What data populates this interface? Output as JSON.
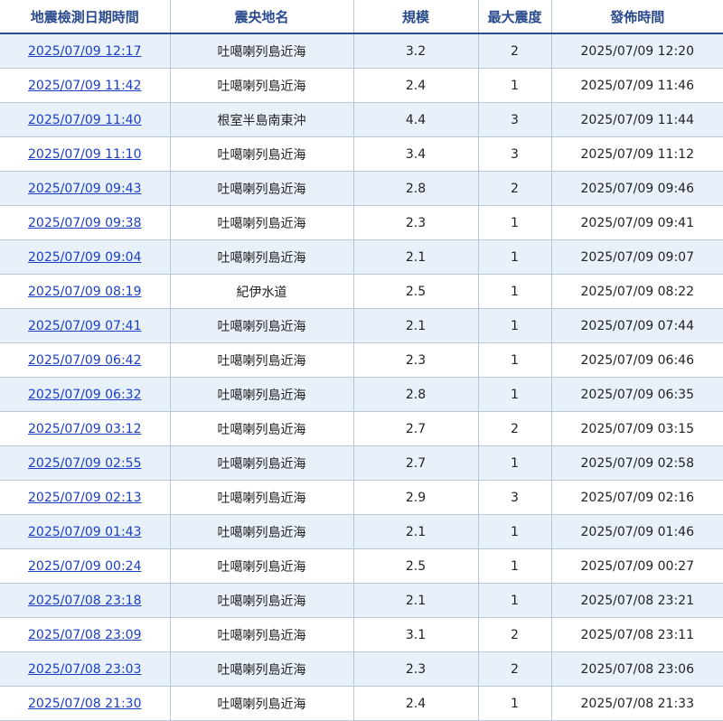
{
  "table": {
    "headers": [
      "地震檢測日期時間",
      "震央地名",
      "規模",
      "最大震度",
      "發佈時間"
    ],
    "rows": [
      {
        "detect_time": "2025/07/09 12:17",
        "epicenter": "吐噶喇列島近海",
        "magnitude": "3.2",
        "max_intensity": "2",
        "publish_time": "2025/07/09 12:20"
      },
      {
        "detect_time": "2025/07/09 11:42",
        "epicenter": "吐噶喇列島近海",
        "magnitude": "2.4",
        "max_intensity": "1",
        "publish_time": "2025/07/09 11:46"
      },
      {
        "detect_time": "2025/07/09 11:40",
        "epicenter": "根室半島南東沖",
        "magnitude": "4.4",
        "max_intensity": "3",
        "publish_time": "2025/07/09 11:44"
      },
      {
        "detect_time": "2025/07/09 11:10",
        "epicenter": "吐噶喇列島近海",
        "magnitude": "3.4",
        "max_intensity": "3",
        "publish_time": "2025/07/09 11:12"
      },
      {
        "detect_time": "2025/07/09 09:43",
        "epicenter": "吐噶喇列島近海",
        "magnitude": "2.8",
        "max_intensity": "2",
        "publish_time": "2025/07/09 09:46"
      },
      {
        "detect_time": "2025/07/09 09:38",
        "epicenter": "吐噶喇列島近海",
        "magnitude": "2.3",
        "max_intensity": "1",
        "publish_time": "2025/07/09 09:41"
      },
      {
        "detect_time": "2025/07/09 09:04",
        "epicenter": "吐噶喇列島近海",
        "magnitude": "2.1",
        "max_intensity": "1",
        "publish_time": "2025/07/09 09:07"
      },
      {
        "detect_time": "2025/07/09 08:19",
        "epicenter": "紀伊水道",
        "magnitude": "2.5",
        "max_intensity": "1",
        "publish_time": "2025/07/09 08:22"
      },
      {
        "detect_time": "2025/07/09 07:41",
        "epicenter": "吐噶喇列島近海",
        "magnitude": "2.1",
        "max_intensity": "1",
        "publish_time": "2025/07/09 07:44"
      },
      {
        "detect_time": "2025/07/09 06:42",
        "epicenter": "吐噶喇列島近海",
        "magnitude": "2.3",
        "max_intensity": "1",
        "publish_time": "2025/07/09 06:46"
      },
      {
        "detect_time": "2025/07/09 06:32",
        "epicenter": "吐噶喇列島近海",
        "magnitude": "2.8",
        "max_intensity": "1",
        "publish_time": "2025/07/09 06:35"
      },
      {
        "detect_time": "2025/07/09 03:12",
        "epicenter": "吐噶喇列島近海",
        "magnitude": "2.7",
        "max_intensity": "2",
        "publish_time": "2025/07/09 03:15"
      },
      {
        "detect_time": "2025/07/09 02:55",
        "epicenter": "吐噶喇列島近海",
        "magnitude": "2.7",
        "max_intensity": "1",
        "publish_time": "2025/07/09 02:58"
      },
      {
        "detect_time": "2025/07/09 02:13",
        "epicenter": "吐噶喇列島近海",
        "magnitude": "2.9",
        "max_intensity": "3",
        "publish_time": "2025/07/09 02:16"
      },
      {
        "detect_time": "2025/07/09 01:43",
        "epicenter": "吐噶喇列島近海",
        "magnitude": "2.1",
        "max_intensity": "1",
        "publish_time": "2025/07/09 01:46"
      },
      {
        "detect_time": "2025/07/09 00:24",
        "epicenter": "吐噶喇列島近海",
        "magnitude": "2.5",
        "max_intensity": "1",
        "publish_time": "2025/07/09 00:27"
      },
      {
        "detect_time": "2025/07/08 23:18",
        "epicenter": "吐噶喇列島近海",
        "magnitude": "2.1",
        "max_intensity": "1",
        "publish_time": "2025/07/08 23:21"
      },
      {
        "detect_time": "2025/07/08 23:09",
        "epicenter": "吐噶喇列島近海",
        "magnitude": "3.1",
        "max_intensity": "2",
        "publish_time": "2025/07/08 23:11"
      },
      {
        "detect_time": "2025/07/08 23:03",
        "epicenter": "吐噶喇列島近海",
        "magnitude": "2.3",
        "max_intensity": "2",
        "publish_time": "2025/07/08 23:06"
      },
      {
        "detect_time": "2025/07/08 21:30",
        "epicenter": "吐噶喇列島近海",
        "magnitude": "2.4",
        "max_intensity": "1",
        "publish_time": "2025/07/08 21:33"
      }
    ]
  },
  "colors": {
    "header_text": "#2a4b8d",
    "link": "#1a3fc4",
    "row_stripe": "#e8f0f9",
    "grid_line": "#b8c6da"
  }
}
